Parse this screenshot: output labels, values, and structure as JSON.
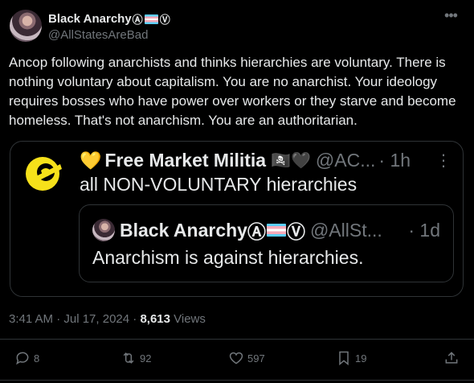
{
  "author": {
    "display_name": "Black Anarchy",
    "symbol_a": "Ⓐ",
    "symbol_v": "Ⓥ",
    "handle": "@AllStatesAreBad"
  },
  "tweet": {
    "text": "Ancop following anarchists and thinks hierarchies are voluntary. There is nothing voluntary about capitalism. You are no anarchist. Your ideology requires bosses who have power over workers or they starve and become homeless. That's not anarchism. You are an authoritarian."
  },
  "quote": {
    "heart": "💛",
    "display_name": "Free Market Militia",
    "emoji": "🏴‍☠️🖤",
    "handle": "@AC...",
    "time": "· 1h",
    "more": "⋮",
    "text": "all NON-VOLUNTARY hierarchies",
    "inner": {
      "display_name": "Black Anarchy",
      "symbol_a": "Ⓐ",
      "symbol_v": "Ⓥ",
      "handle": "@AllSt...",
      "time": "· 1d",
      "text": "Anarchism is against hierarchies."
    }
  },
  "meta": {
    "time": "3:41 AM · Jul 17, 2024 · ",
    "views_count": "8,613",
    "views_label": " Views"
  },
  "actions": {
    "replies": "8",
    "reposts": "92",
    "likes": "597",
    "bookmarks": "19"
  },
  "icons": [
    "more-horizontal-icon",
    "reply-icon",
    "repost-icon",
    "like-icon",
    "bookmark-icon",
    "share-icon"
  ],
  "colors": {
    "background": "#000000",
    "text": "#e7e9ea",
    "secondary": "#71767b",
    "border": "#2f3336",
    "logo_yellow": "#f6e11a"
  }
}
